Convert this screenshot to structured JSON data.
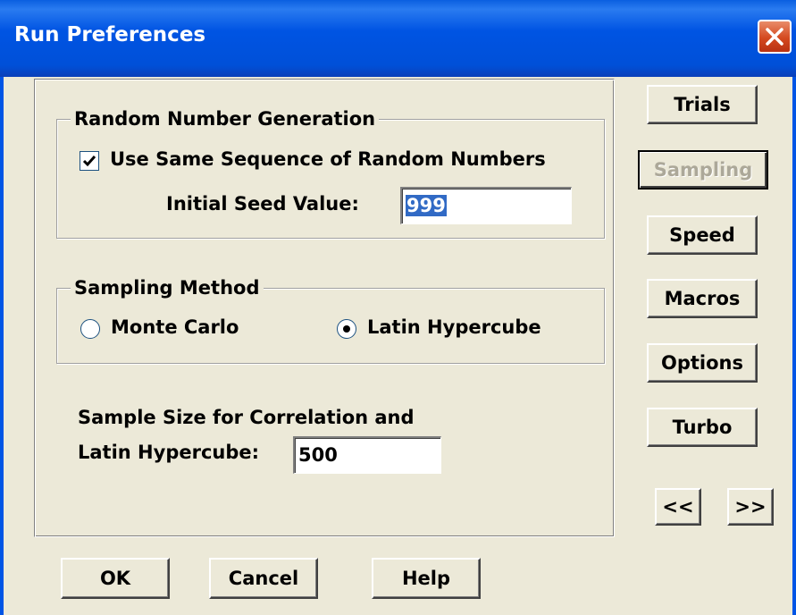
{
  "window": {
    "title": "Run Preferences"
  },
  "random_group": {
    "legend": "Random Number Generation",
    "same_sequence_label": "Use Same Sequence of Random Numbers",
    "same_sequence_checked": true,
    "seed_label": "Initial Seed Value:",
    "seed_value": "999"
  },
  "sampling_group": {
    "legend": "Sampling Method",
    "options": [
      "Monte Carlo",
      "Latin Hypercube"
    ],
    "selected": "Latin Hypercube"
  },
  "sample_size": {
    "label_line1": "Sample Size for Correlation and",
    "label_line2": "Latin Hypercube:",
    "value": "500"
  },
  "side_buttons": {
    "trials": "Trials",
    "sampling": "Sampling",
    "speed": "Speed",
    "macros": "Macros",
    "options": "Options",
    "turbo": "Turbo",
    "prev": "<<",
    "next": ">>"
  },
  "footer_buttons": {
    "ok": "OK",
    "cancel": "Cancel",
    "help": "Help"
  }
}
